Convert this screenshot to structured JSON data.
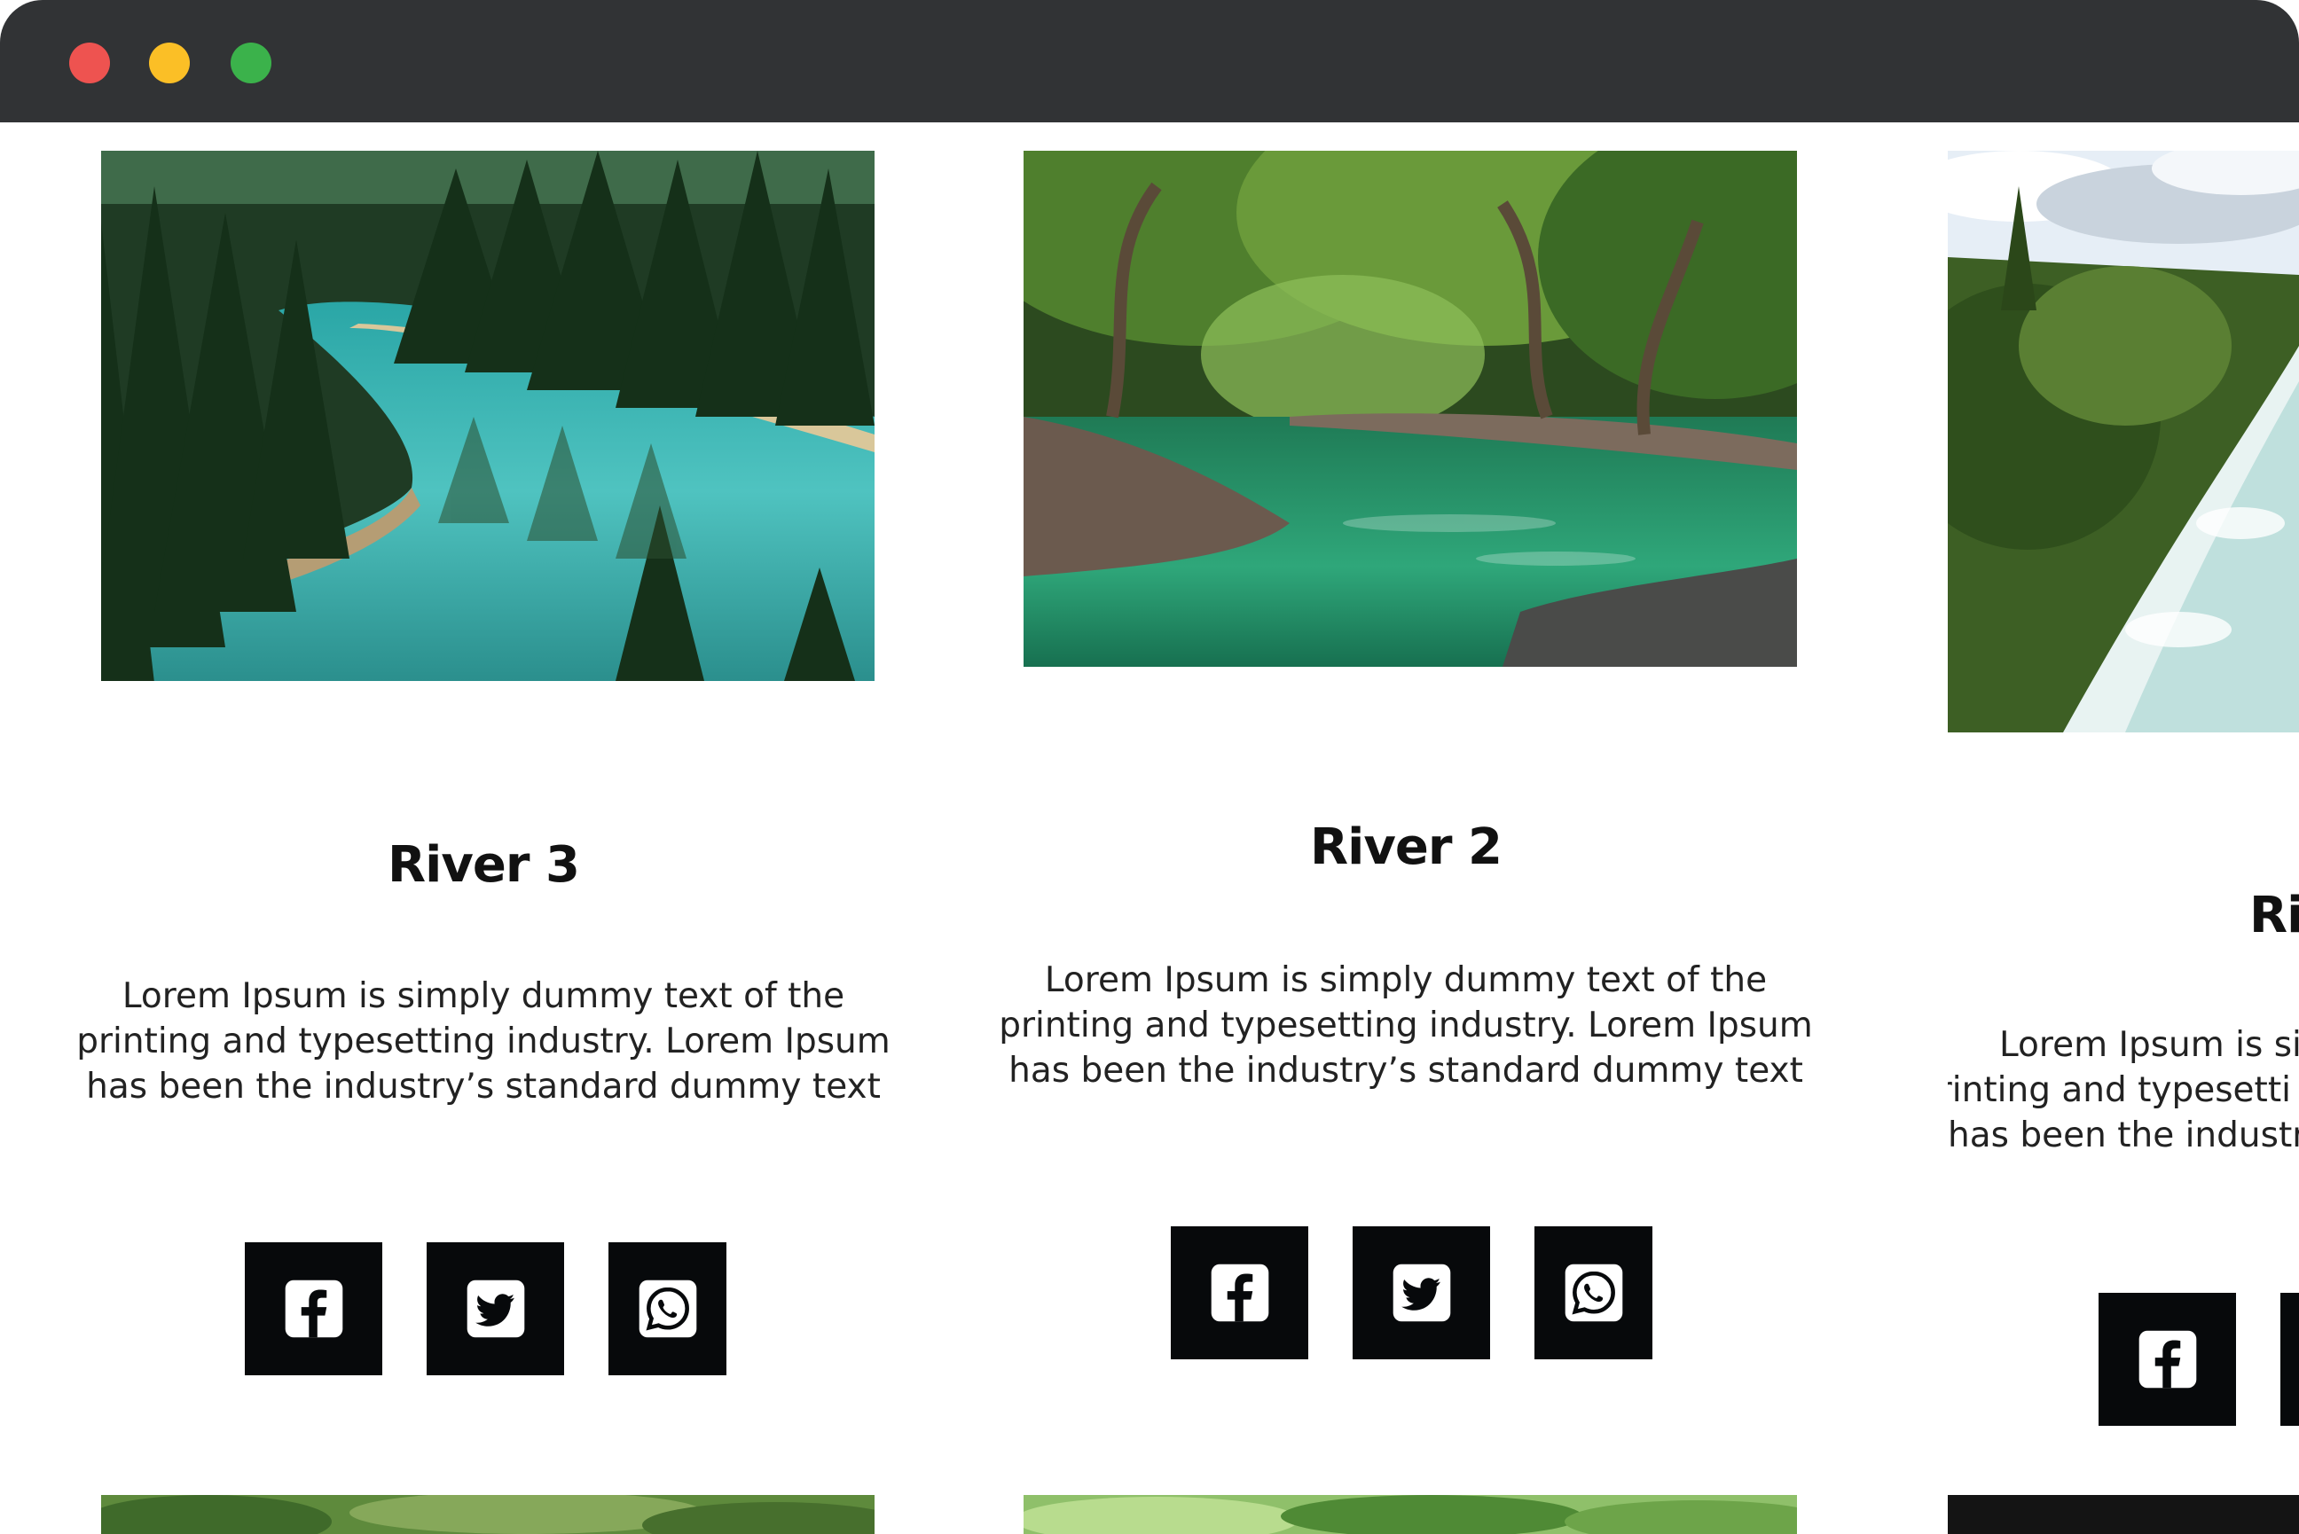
{
  "window": {
    "controls": [
      "close",
      "minimize",
      "maximize"
    ]
  },
  "cards": [
    {
      "title": "River 3",
      "description": "Lorem Ipsum is simply dummy text of the printing and typesetting industry. Lorem Ipsum has been the industry’s standard dummy text",
      "image_subject": "turquoise river winding through pine forest",
      "social": [
        "facebook-icon",
        "twitter-icon",
        "whatsapp-icon"
      ]
    },
    {
      "title": "River 2",
      "description": "Lorem Ipsum is simply dummy text of the printing and typesetting industry. Lorem Ipsum has been the industry’s standard dummy text",
      "image_subject": "green river under shaded trees with rocky banks",
      "social": [
        "facebook-icon",
        "twitter-icon",
        "whatsapp-icon"
      ]
    },
    {
      "title": "Ri",
      "description_lines": [
        "Lorem Ipsum is sim",
        "printing and typesetti",
        "has been the industr"
      ],
      "image_subject": "rushing white-water river beside green bank under cloudy sky",
      "social": [
        "facebook-icon"
      ]
    }
  ],
  "colors": {
    "titlebar": "#313335",
    "close": "#ee5350",
    "minimize": "#fbbf26",
    "maximize": "#3bb24b",
    "social_button_bg": "#07090b"
  }
}
